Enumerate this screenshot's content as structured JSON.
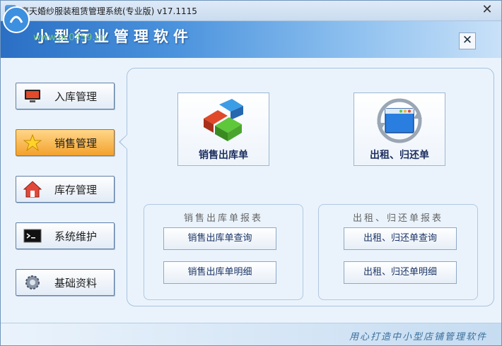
{
  "window": {
    "title": "豪天婚纱服装租赁管理系统(专业版) v17.1115"
  },
  "banner": {
    "title": "小型行业管理软件",
    "watermark": "www.pc0359.cn"
  },
  "sidebar": {
    "items": [
      {
        "label": "入库管理",
        "icon": "monitor-icon"
      },
      {
        "label": "销售管理",
        "icon": "star-icon",
        "active": true
      },
      {
        "label": "库存管理",
        "icon": "house-icon"
      },
      {
        "label": "系统维护",
        "icon": "terminal-icon"
      },
      {
        "label": "基础资料",
        "icon": "gear-icon"
      }
    ]
  },
  "main": {
    "big_buttons": [
      {
        "label": "销售出库单",
        "icon": "blocks-icon"
      },
      {
        "label": "出租、归还单",
        "icon": "refresh-window-icon"
      }
    ],
    "groups": [
      {
        "title": "销售出库单报表",
        "items": [
          "销售出库单查询",
          "销售出库单明细"
        ]
      },
      {
        "title": "出租、归还单报表",
        "items": [
          "出租、归还单查询",
          "出租、归还单明细"
        ]
      }
    ]
  },
  "footer": {
    "slogan": "用心打造中小型店铺管理软件"
  },
  "colors": {
    "active_nav": "#f3a12c",
    "banner": "#2a6fc4",
    "panel_border": "#a7c3de"
  }
}
